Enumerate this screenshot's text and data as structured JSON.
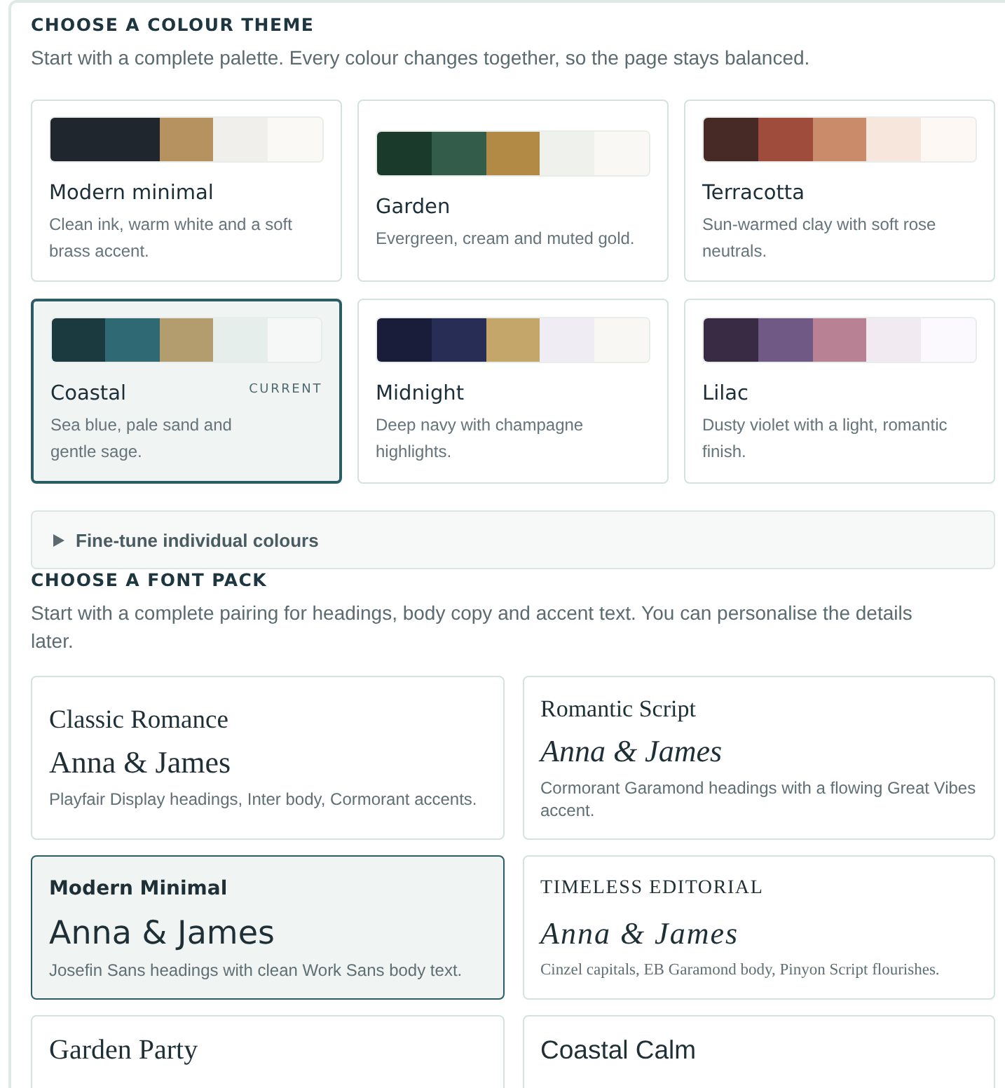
{
  "colour_theme": {
    "heading": "CHOOSE A COLOUR THEME",
    "subtitle": "Start with a complete palette. Every colour changes together, so the page stays balanced.",
    "themes": [
      {
        "name": "Modern minimal",
        "description": "Clean ink, warm white and a soft brass accent.",
        "selected": false,
        "swatches": [
          {
            "color": "#1f262e"
          },
          {
            "color": "#1f262e"
          },
          {
            "color": "#b5925f"
          },
          {
            "color": "#f0efeb"
          },
          {
            "color": "#faf9f6"
          }
        ]
      },
      {
        "name": "Garden",
        "description": "Evergreen, cream and muted gold.",
        "selected": false,
        "swatches": [
          {
            "color": "#1a3a2c"
          },
          {
            "color": "#345c4a"
          },
          {
            "color": "#b38a45"
          },
          {
            "color": "#eff2ec"
          },
          {
            "color": "#f9f8f4"
          }
        ]
      },
      {
        "name": "Terracotta",
        "description": "Sun-warmed clay with soft rose neutrals.",
        "selected": false,
        "swatches": [
          {
            "color": "#472a25"
          },
          {
            "color": "#a04c3c"
          },
          {
            "color": "#c98b69"
          },
          {
            "color": "#f6e6dc"
          },
          {
            "color": "#fdf8f4"
          }
        ]
      },
      {
        "name": "Coastal",
        "description": "Sea blue, pale sand and gentle sage.",
        "selected": true,
        "badge": "CURRENT",
        "swatches": [
          {
            "color": "#1b3a40"
          },
          {
            "color": "#2f6a74"
          },
          {
            "color": "#b39c6d"
          },
          {
            "color": "#e6eeeb"
          },
          {
            "color": "#f6f8f7"
          }
        ]
      },
      {
        "name": "Midnight",
        "description": "Deep navy with champagne highlights.",
        "selected": false,
        "swatches": [
          {
            "color": "#1a1d3a"
          },
          {
            "color": "#272d54"
          },
          {
            "color": "#c4a66a"
          },
          {
            "color": "#efedf3"
          },
          {
            "color": "#f8f7f4"
          }
        ]
      },
      {
        "name": "Lilac",
        "description": "Dusty violet with a light, romantic finish.",
        "selected": false,
        "swatches": [
          {
            "color": "#3a2b45"
          },
          {
            "color": "#705a85"
          },
          {
            "color": "#b88294"
          },
          {
            "color": "#f1eaf1"
          },
          {
            "color": "#fbf9fd"
          }
        ]
      }
    ]
  },
  "fine_tune": {
    "label": "Fine-tune individual colours",
    "expanded": false
  },
  "font_pack": {
    "heading": "CHOOSE A FONT PACK",
    "subtitle": "Start with a complete pairing for headings, body copy and accent text. You can personalise the details later.",
    "packs": [
      {
        "kind": "classic",
        "title": "Classic Romance",
        "sample": "Anna & James",
        "description": "Playfair Display headings, Inter body, Cormorant accents.",
        "selected": false
      },
      {
        "kind": "romantic",
        "title": "Romantic Script",
        "sample": "Anna & James",
        "description": "Cormorant Garamond headings with a flowing Great Vibes accent.",
        "selected": false
      },
      {
        "kind": "modern",
        "title": "Modern Minimal",
        "sample": "Anna & James",
        "description": "Josefin Sans headings with clean Work Sans body text.",
        "selected": true
      },
      {
        "kind": "editorial",
        "title": "TIMELESS EDITORIAL",
        "sample": "Anna & James",
        "description": "Cinzel capitals, EB Garamond body, Pinyon Script flourishes.",
        "selected": false
      },
      {
        "kind": "garden",
        "title": "Garden Party",
        "selected": false
      },
      {
        "kind": "coastal",
        "title": "Coastal Calm",
        "selected": false
      }
    ]
  }
}
